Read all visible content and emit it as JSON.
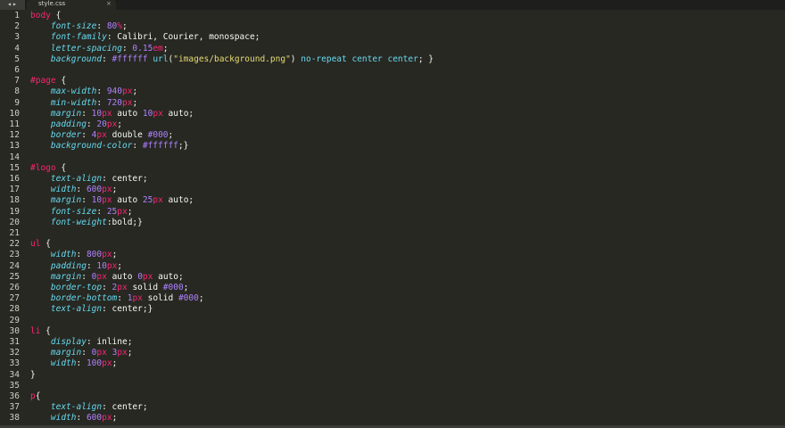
{
  "tab": {
    "filename": "style.css",
    "close_glyph": "×"
  },
  "colors": {
    "background": "#272822",
    "selector": "#f92672",
    "property": "#66d9ef",
    "number": "#ae81ff",
    "string": "#e6db74",
    "text": "#f8f8f2"
  },
  "lines": [
    {
      "n": "1",
      "tokens": [
        [
          "sel",
          "body"
        ],
        [
          "plain",
          " {"
        ]
      ]
    },
    {
      "n": "2",
      "tokens": [
        [
          "plain",
          "    "
        ],
        [
          "prop",
          "font-size"
        ],
        [
          "plain",
          ": "
        ],
        [
          "num",
          "80"
        ],
        [
          "unit",
          "%"
        ],
        [
          "plain",
          ";"
        ]
      ]
    },
    {
      "n": "3",
      "tokens": [
        [
          "plain",
          "    "
        ],
        [
          "prop",
          "font-family"
        ],
        [
          "plain",
          ": Calibri, Courier, monospace;"
        ]
      ]
    },
    {
      "n": "4",
      "tokens": [
        [
          "plain",
          "    "
        ],
        [
          "prop",
          "letter-spacing"
        ],
        [
          "plain",
          ": "
        ],
        [
          "num",
          "0.15"
        ],
        [
          "unit",
          "em"
        ],
        [
          "plain",
          ";"
        ]
      ]
    },
    {
      "n": "5",
      "tokens": [
        [
          "plain",
          "    "
        ],
        [
          "prop",
          "background"
        ],
        [
          "plain",
          ": "
        ],
        [
          "num",
          "#ffffff"
        ],
        [
          "plain",
          " "
        ],
        [
          "kw",
          "url"
        ],
        [
          "plain",
          "("
        ],
        [
          "str",
          "\"images/background.png\""
        ],
        [
          "plain",
          ") "
        ],
        [
          "kw",
          "no-repeat center center"
        ],
        [
          "plain",
          "; }"
        ]
      ]
    },
    {
      "n": "6",
      "tokens": []
    },
    {
      "n": "7",
      "tokens": [
        [
          "sel",
          "#page"
        ],
        [
          "plain",
          " {"
        ]
      ]
    },
    {
      "n": "8",
      "tokens": [
        [
          "plain",
          "    "
        ],
        [
          "prop",
          "max-width"
        ],
        [
          "plain",
          ": "
        ],
        [
          "num",
          "940"
        ],
        [
          "unit",
          "px"
        ],
        [
          "plain",
          ";"
        ]
      ]
    },
    {
      "n": "9",
      "tokens": [
        [
          "plain",
          "    "
        ],
        [
          "prop",
          "min-width"
        ],
        [
          "plain",
          ": "
        ],
        [
          "num",
          "720"
        ],
        [
          "unit",
          "px"
        ],
        [
          "plain",
          ";"
        ]
      ]
    },
    {
      "n": "10",
      "tokens": [
        [
          "plain",
          "    "
        ],
        [
          "prop",
          "margin"
        ],
        [
          "plain",
          ": "
        ],
        [
          "num",
          "10"
        ],
        [
          "unit",
          "px"
        ],
        [
          "plain",
          " auto "
        ],
        [
          "num",
          "10"
        ],
        [
          "unit",
          "px"
        ],
        [
          "plain",
          " auto;"
        ]
      ]
    },
    {
      "n": "11",
      "tokens": [
        [
          "plain",
          "    "
        ],
        [
          "prop",
          "padding"
        ],
        [
          "plain",
          ": "
        ],
        [
          "num",
          "20"
        ],
        [
          "unit",
          "px"
        ],
        [
          "plain",
          ";"
        ]
      ]
    },
    {
      "n": "12",
      "tokens": [
        [
          "plain",
          "    "
        ],
        [
          "prop",
          "border"
        ],
        [
          "plain",
          ": "
        ],
        [
          "num",
          "4"
        ],
        [
          "unit",
          "px"
        ],
        [
          "plain",
          " double "
        ],
        [
          "num",
          "#000"
        ],
        [
          "plain",
          ";"
        ]
      ]
    },
    {
      "n": "13",
      "tokens": [
        [
          "plain",
          "    "
        ],
        [
          "prop",
          "background-color"
        ],
        [
          "plain",
          ": "
        ],
        [
          "num",
          "#ffffff"
        ],
        [
          "plain",
          ";}"
        ]
      ]
    },
    {
      "n": "14",
      "tokens": []
    },
    {
      "n": "15",
      "tokens": [
        [
          "sel",
          "#logo"
        ],
        [
          "plain",
          " {"
        ]
      ]
    },
    {
      "n": "16",
      "tokens": [
        [
          "plain",
          "    "
        ],
        [
          "prop",
          "text-align"
        ],
        [
          "plain",
          ": center;"
        ]
      ]
    },
    {
      "n": "17",
      "tokens": [
        [
          "plain",
          "    "
        ],
        [
          "prop",
          "width"
        ],
        [
          "plain",
          ": "
        ],
        [
          "num",
          "600"
        ],
        [
          "unit",
          "px"
        ],
        [
          "plain",
          ";"
        ]
      ]
    },
    {
      "n": "18",
      "tokens": [
        [
          "plain",
          "    "
        ],
        [
          "prop",
          "margin"
        ],
        [
          "plain",
          ": "
        ],
        [
          "num",
          "10"
        ],
        [
          "unit",
          "px"
        ],
        [
          "plain",
          " auto "
        ],
        [
          "num",
          "25"
        ],
        [
          "unit",
          "px"
        ],
        [
          "plain",
          " auto;"
        ]
      ]
    },
    {
      "n": "19",
      "tokens": [
        [
          "plain",
          "    "
        ],
        [
          "prop",
          "font-size"
        ],
        [
          "plain",
          ": "
        ],
        [
          "num",
          "25"
        ],
        [
          "unit",
          "px"
        ],
        [
          "plain",
          ";"
        ]
      ]
    },
    {
      "n": "20",
      "tokens": [
        [
          "plain",
          "    "
        ],
        [
          "prop",
          "font-weight"
        ],
        [
          "plain",
          ":bold;}"
        ]
      ]
    },
    {
      "n": "21",
      "tokens": []
    },
    {
      "n": "22",
      "tokens": [
        [
          "sel",
          "ul"
        ],
        [
          "plain",
          " {"
        ]
      ]
    },
    {
      "n": "23",
      "tokens": [
        [
          "plain",
          "    "
        ],
        [
          "prop",
          "width"
        ],
        [
          "plain",
          ": "
        ],
        [
          "num",
          "800"
        ],
        [
          "unit",
          "px"
        ],
        [
          "plain",
          ";"
        ]
      ]
    },
    {
      "n": "24",
      "tokens": [
        [
          "plain",
          "    "
        ],
        [
          "prop",
          "padding"
        ],
        [
          "plain",
          ": "
        ],
        [
          "num",
          "10"
        ],
        [
          "unit",
          "px"
        ],
        [
          "plain",
          ";"
        ]
      ]
    },
    {
      "n": "25",
      "tokens": [
        [
          "plain",
          "    "
        ],
        [
          "prop",
          "margin"
        ],
        [
          "plain",
          ": "
        ],
        [
          "num",
          "0"
        ],
        [
          "unit",
          "px"
        ],
        [
          "plain",
          " auto "
        ],
        [
          "num",
          "0"
        ],
        [
          "unit",
          "px"
        ],
        [
          "plain",
          " auto;"
        ]
      ]
    },
    {
      "n": "26",
      "tokens": [
        [
          "plain",
          "    "
        ],
        [
          "prop",
          "border-top"
        ],
        [
          "plain",
          ": "
        ],
        [
          "num",
          "2"
        ],
        [
          "unit",
          "px"
        ],
        [
          "plain",
          " solid "
        ],
        [
          "num",
          "#000"
        ],
        [
          "plain",
          ";"
        ]
      ]
    },
    {
      "n": "27",
      "tokens": [
        [
          "plain",
          "    "
        ],
        [
          "prop",
          "border-bottom"
        ],
        [
          "plain",
          ": "
        ],
        [
          "num",
          "1"
        ],
        [
          "unit",
          "px"
        ],
        [
          "plain",
          " solid "
        ],
        [
          "num",
          "#000"
        ],
        [
          "plain",
          ";"
        ]
      ]
    },
    {
      "n": "28",
      "tokens": [
        [
          "plain",
          "    "
        ],
        [
          "prop",
          "text-align"
        ],
        [
          "plain",
          ": center;}"
        ]
      ]
    },
    {
      "n": "29",
      "tokens": []
    },
    {
      "n": "30",
      "tokens": [
        [
          "sel",
          "li"
        ],
        [
          "plain",
          " {"
        ]
      ]
    },
    {
      "n": "31",
      "tokens": [
        [
          "plain",
          "    "
        ],
        [
          "prop",
          "display"
        ],
        [
          "plain",
          ": inline;"
        ]
      ]
    },
    {
      "n": "32",
      "tokens": [
        [
          "plain",
          "    "
        ],
        [
          "prop",
          "margin"
        ],
        [
          "plain",
          ": "
        ],
        [
          "num",
          "0"
        ],
        [
          "unit",
          "px"
        ],
        [
          "plain",
          " "
        ],
        [
          "num",
          "3"
        ],
        [
          "unit",
          "px"
        ],
        [
          "plain",
          ";"
        ]
      ]
    },
    {
      "n": "33",
      "tokens": [
        [
          "plain",
          "    "
        ],
        [
          "prop",
          "width"
        ],
        [
          "plain",
          ": "
        ],
        [
          "num",
          "100"
        ],
        [
          "unit",
          "px"
        ],
        [
          "plain",
          ";"
        ]
      ]
    },
    {
      "n": "34",
      "tokens": [
        [
          "plain",
          "}"
        ]
      ]
    },
    {
      "n": "35",
      "tokens": []
    },
    {
      "n": "36",
      "tokens": [
        [
          "sel",
          "p"
        ],
        [
          "plain",
          "{"
        ]
      ]
    },
    {
      "n": "37",
      "tokens": [
        [
          "plain",
          "    "
        ],
        [
          "prop",
          "text-align"
        ],
        [
          "plain",
          ": center;"
        ]
      ]
    },
    {
      "n": "38",
      "tokens": [
        [
          "plain",
          "    "
        ],
        [
          "prop",
          "width"
        ],
        [
          "plain",
          ": "
        ],
        [
          "num",
          "600"
        ],
        [
          "unit",
          "px"
        ],
        [
          "plain",
          ";"
        ]
      ]
    }
  ]
}
